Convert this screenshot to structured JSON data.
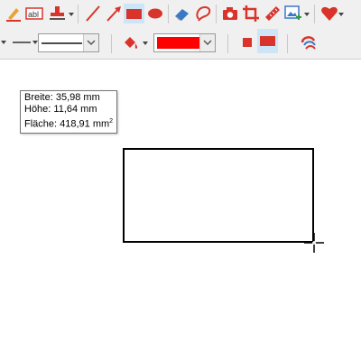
{
  "toolbar_top": {
    "tools": [
      {
        "name": "highlighter-icon",
        "label": ""
      },
      {
        "name": "text-field-icon",
        "label": "abl"
      },
      {
        "name": "stamp-icon",
        "label": ""
      },
      {
        "name": "line-icon",
        "label": ""
      },
      {
        "name": "arrow-icon",
        "label": ""
      },
      {
        "name": "rectangle-icon",
        "label": "",
        "active": true
      },
      {
        "name": "ellipse-icon",
        "label": ""
      },
      {
        "name": "eraser-icon",
        "label": ""
      },
      {
        "name": "lasso-icon",
        "label": ""
      },
      {
        "name": "camera-icon",
        "label": ""
      },
      {
        "name": "crop-icon",
        "label": ""
      },
      {
        "name": "ruler-icon",
        "label": ""
      },
      {
        "name": "image-add-icon",
        "label": ""
      },
      {
        "name": "heart-icon",
        "label": ""
      }
    ]
  },
  "toolbar_bottom": {
    "line_style_value": "solid",
    "line_weight_value": "solid",
    "fill_color": "#ff0000",
    "fill_mode": [
      "filled-square",
      "filled-wide-square"
    ],
    "tools": [
      "fill-bucket-icon",
      "color-combo",
      "filled-square-icon",
      "filled-rect-icon",
      "ribbon-icon"
    ]
  },
  "tooltip": {
    "breite": "Breite: 35,98 mm",
    "hoehe": "Höhe: 11,64 mm",
    "flaeche": "Fläche: 418,91 mm",
    "flaeche_unit_sup": "2"
  },
  "colors": {
    "accent_red": "#d9342b",
    "toolbar_bg": "#f0f0f0",
    "active_bg": "#cde6f7",
    "shape_stroke": "#000000"
  }
}
